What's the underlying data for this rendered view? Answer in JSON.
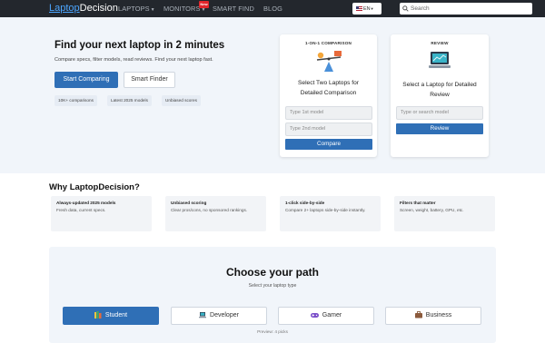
{
  "nav": {
    "logo_part1": "Laptop",
    "logo_part2": "Decision",
    "items": [
      {
        "label": "LAPTOPS",
        "dropdown": true
      },
      {
        "label": "MONITORS",
        "dropdown": true
      },
      {
        "label": "SMART FIND",
        "dropdown": false
      },
      {
        "label": "BLOG",
        "dropdown": false
      }
    ],
    "new_badge": "New",
    "language": "EN",
    "search_placeholder": "Search"
  },
  "hero": {
    "title": "Find your next laptop in 2 minutes",
    "subtitle": "Compare specs, filter models, read reviews. Find your next laptop fast.",
    "primary_button": "Start Comparing",
    "secondary_button": "Smart Finder",
    "chips": [
      "10K+ comparisons",
      "Latest 2025 models",
      "Unbiased scores"
    ]
  },
  "compare_card": {
    "caption": "1-ON-1 COMPARISON",
    "title": "Select Two Laptops for Detailed Comparison",
    "input1_placeholder": "Type 1st model",
    "input2_placeholder": "Type 2nd model",
    "button": "Compare"
  },
  "review_card": {
    "caption": "REVIEW",
    "title": "Select a Laptop for Detailed Review",
    "input_placeholder": "Type or search model",
    "button": "Review"
  },
  "why": {
    "title": "Why LaptopDecision?",
    "features": [
      {
        "heading": "Always-updated 2025 models",
        "desc": "Fresh data, current specs."
      },
      {
        "heading": "Unbiased scoring",
        "desc": "Clear pros/cons, no sponsored rankings."
      },
      {
        "heading": "1-click side-by-side",
        "desc": "Compare 2+ laptops side-by-side instantly."
      },
      {
        "heading": "Filters that matter",
        "desc": "Screen, weight, battery, GPU, etc."
      }
    ]
  },
  "path": {
    "title": "Choose your path",
    "subtitle": "Select your laptop type",
    "options": [
      {
        "label": "Student",
        "icon": "books-icon",
        "active": true
      },
      {
        "label": "Developer",
        "icon": "laptop-icon",
        "active": false
      },
      {
        "label": "Gamer",
        "icon": "gamepad-icon",
        "active": false
      },
      {
        "label": "Business",
        "icon": "briefcase-icon",
        "active": false
      }
    ],
    "preview": "Preview: 4 picks"
  },
  "colors": {
    "nav_bg": "#23272d",
    "accent": "#2f6fb6",
    "hero_bg": "#f1f5fa",
    "badge_red": "#e0252b"
  }
}
